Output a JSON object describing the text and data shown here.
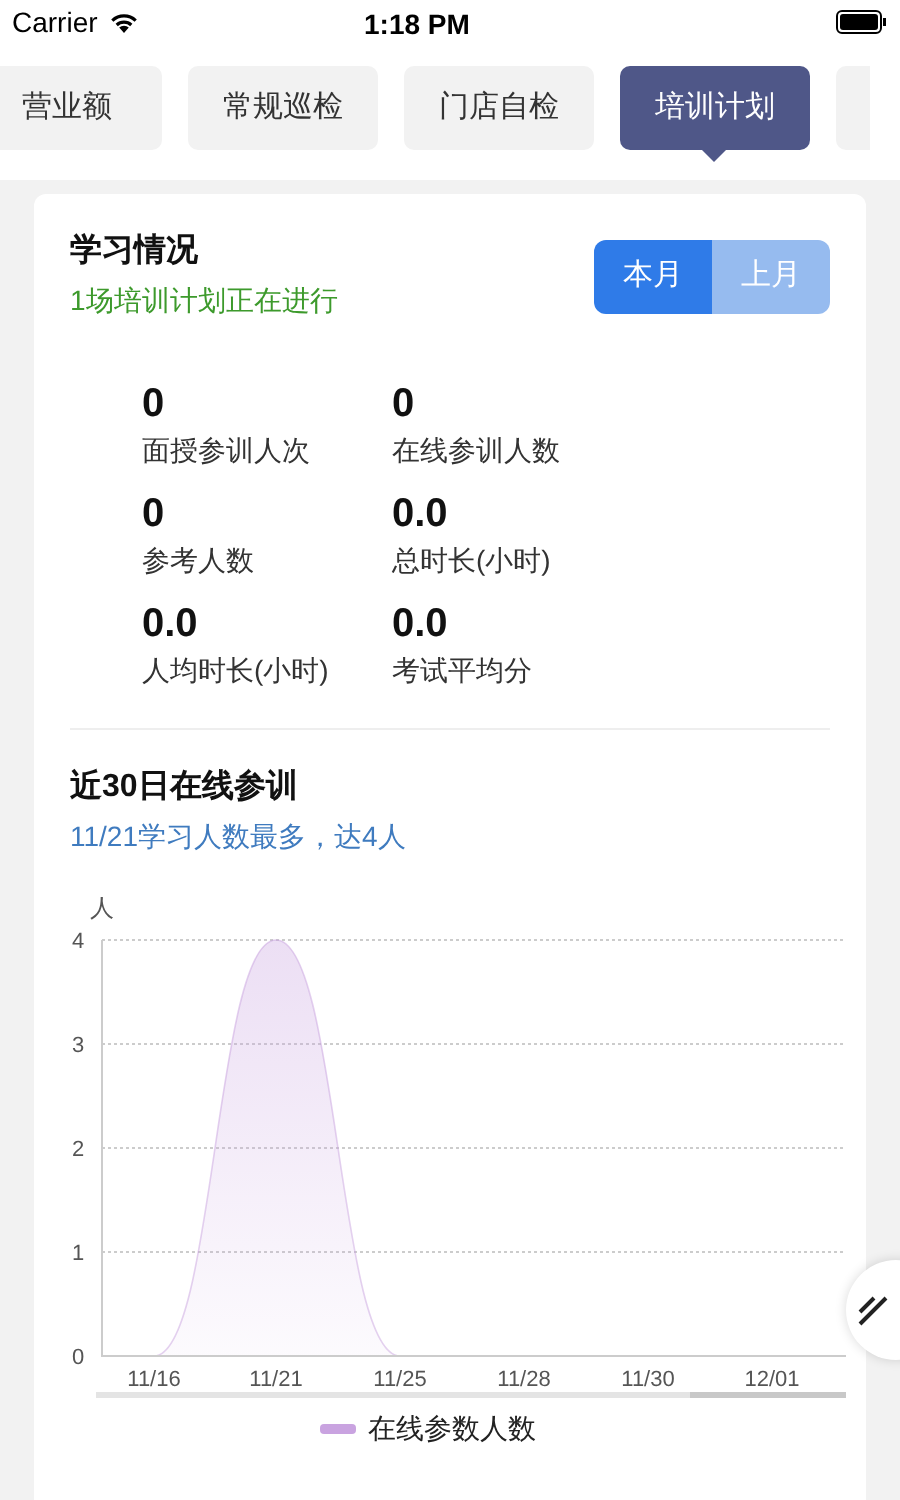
{
  "status_bar": {
    "carrier": "Carrier",
    "time": "1:18 PM"
  },
  "tabs": [
    {
      "label": "营业额",
      "selected": false
    },
    {
      "label": "常规巡检",
      "selected": false
    },
    {
      "label": "门店自检",
      "selected": false
    },
    {
      "label": "培训计划",
      "selected": true
    }
  ],
  "study": {
    "title": "学习情况",
    "subtitle": "1场培训计划正在进行",
    "periods": [
      {
        "label": "本月",
        "selected": true
      },
      {
        "label": "上月",
        "selected": false
      }
    ],
    "stats": [
      {
        "value": "0",
        "label": "面授参训人次"
      },
      {
        "value": "0",
        "label": "在线参训人数"
      },
      {
        "value": "0",
        "label": "参考人数"
      },
      {
        "value": "0.0",
        "label": "总时长(小时)"
      },
      {
        "value": "0.0",
        "label": "人均时长(小时)"
      },
      {
        "value": "0.0",
        "label": "考试平均分"
      }
    ]
  },
  "online": {
    "title": "近30日在线参训",
    "subtitle": "11/21学习人数最多，达4人",
    "chart_data": {
      "type": "area",
      "ylabel": "人",
      "categories": [
        "11/16",
        "11/21",
        "11/25",
        "11/28",
        "11/30",
        "12/01"
      ],
      "ylim": [
        0,
        4
      ],
      "grid": true,
      "yticks": [
        0,
        1,
        2,
        3,
        4
      ],
      "series": [
        {
          "name": "在线参数人数",
          "color": "#c9a3e0",
          "values": [
            0,
            4,
            0,
            0,
            0,
            0
          ]
        }
      ]
    }
  }
}
